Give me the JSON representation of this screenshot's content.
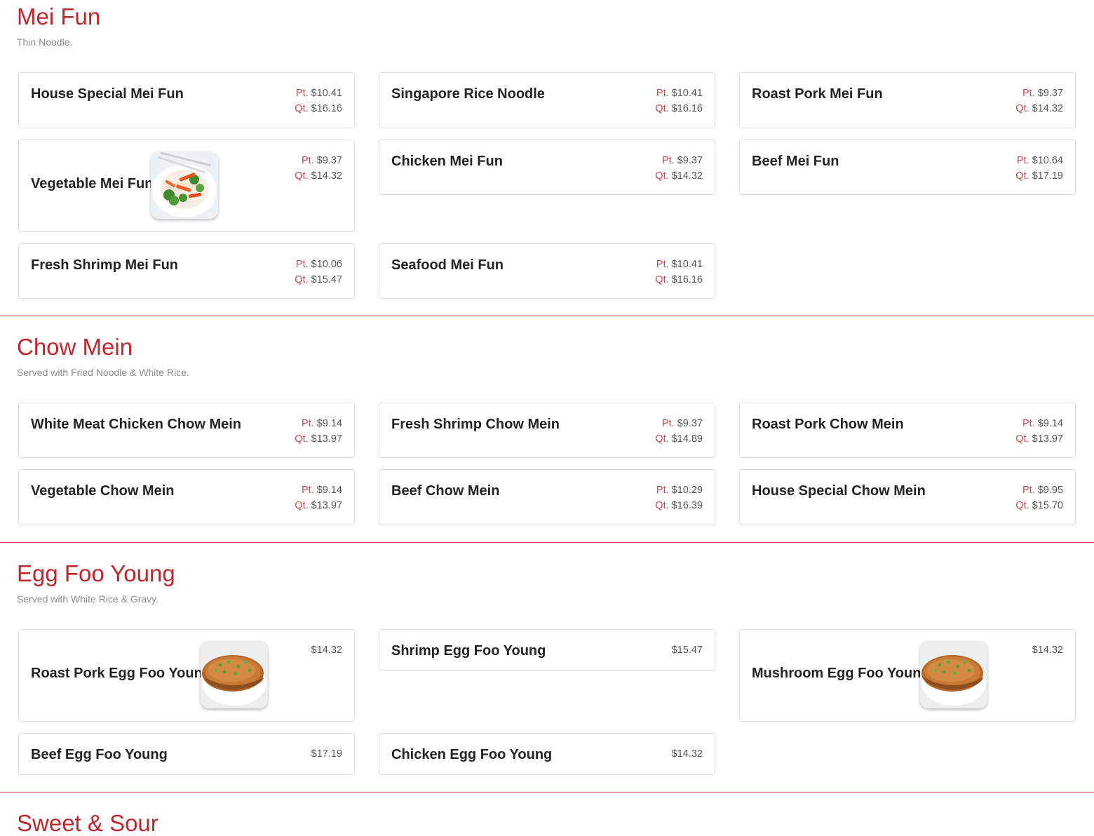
{
  "labels": {
    "pint": "Pt.",
    "quart": "Qt."
  },
  "sections": [
    {
      "title": "Mei Fun",
      "description": "Thin Noodle.",
      "items": [
        {
          "name": "House Special Mei Fun",
          "pt": "$10.41",
          "qt": "$16.16"
        },
        {
          "name": "Singapore Rice Noodle",
          "pt": "$10.41",
          "qt": "$16.16"
        },
        {
          "name": "Roast Pork Mei Fun",
          "pt": "$9.37",
          "qt": "$14.32"
        },
        {
          "name": "Vegetable Mei Fun",
          "pt": "$9.37",
          "qt": "$14.32",
          "image": "vegetable-mei-fun-photo"
        },
        {
          "name": "Chicken Mei Fun",
          "pt": "$9.37",
          "qt": "$14.32"
        },
        {
          "name": "Beef Mei Fun",
          "pt": "$10.64",
          "qt": "$17.19"
        },
        {
          "name": "Fresh Shrimp Mei Fun",
          "pt": "$10.06",
          "qt": "$15.47"
        },
        {
          "name": "Seafood Mei Fun",
          "pt": "$10.41",
          "qt": "$16.16"
        }
      ]
    },
    {
      "title": "Chow Mein",
      "description": "Served with Fried Noodle & White Rice.",
      "items": [
        {
          "name": "White Meat Chicken Chow Mein",
          "pt": "$9.14",
          "qt": "$13.97"
        },
        {
          "name": "Fresh Shrimp Chow Mein",
          "pt": "$9.37",
          "qt": "$14.89"
        },
        {
          "name": "Roast Pork Chow Mein",
          "pt": "$9.14",
          "qt": "$13.97"
        },
        {
          "name": "Vegetable Chow Mein",
          "pt": "$9.14",
          "qt": "$13.97"
        },
        {
          "name": "Beef Chow Mein",
          "pt": "$10.29",
          "qt": "$16.39"
        },
        {
          "name": "House Special Chow Mein",
          "pt": "$9.95",
          "qt": "$15.70"
        }
      ]
    },
    {
      "title": "Egg Foo Young",
      "description": "Served with White Rice & Gravy.",
      "items": [
        {
          "name": "Roast Pork Egg Foo Young",
          "price": "$14.32",
          "image": "egg-foo-young-photo"
        },
        {
          "name": "Shrimp Egg Foo Young",
          "price": "$15.47"
        },
        {
          "name": "Mushroom Egg Foo Young",
          "price": "$14.32",
          "image": "egg-foo-young-photo"
        },
        {
          "name": "Beef Egg Foo Young",
          "price": "$17.19"
        },
        {
          "name": "Chicken Egg Foo Young",
          "price": "$14.32"
        }
      ]
    },
    {
      "title": "Sweet & Sour",
      "description": "",
      "items": []
    }
  ]
}
